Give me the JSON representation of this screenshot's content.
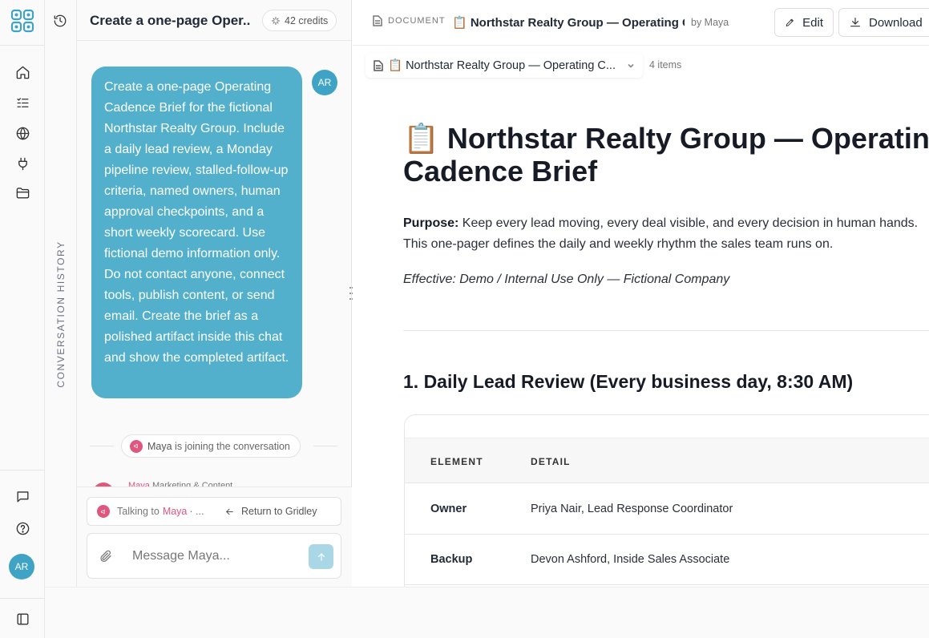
{
  "rail": {
    "avatar_initials": "AR",
    "icons": [
      "home-icon",
      "tasks-icon",
      "globe-icon",
      "plug-icon",
      "folder-icon",
      "chat-icon",
      "help-icon",
      "sidebar-toggle-icon"
    ],
    "accent_color": "#3fa3c6"
  },
  "history": {
    "label": "CONVERSATION HISTORY"
  },
  "chat": {
    "title": "Create a one-page Oper...",
    "credits": "42 credits",
    "user_initials": "AR",
    "message": "Create a one-page Operating Cadence Brief for the fictional Northstar Realty Group. Include a daily lead review, a Monday pipeline review, stalled-follow-up criteria, named owners, human approval checkpoints, and a short weekly scorecard. Use fictional demo information only. Do not contact anyone, connect tools, publish content, or send email. Create the brief as a polished artifact inside this chat and show the completed artifact.",
    "join_name": "Maya",
    "join_text": " is joining the conversation",
    "peek_name": "Maya",
    "peek_role": "Marketing & Content",
    "talking_prefix": "Talking to",
    "talking_name": "Maya",
    "talking_suffix": " · ...",
    "return_label": "Return to Gridley",
    "input_placeholder": "Message Maya...",
    "bubble_color": "#52b0cc",
    "maya_color": "#e0567e"
  },
  "document": {
    "tag": "DOCUMENT",
    "title_short": "📋 Northstar Realty Group — Operating C...",
    "by": "by Maya",
    "edit_label": "Edit",
    "download_label": "Download",
    "file_name": "📋 Northstar Realty Group — Operating C...",
    "items_count": "4 items",
    "heading": "📋 Northstar Realty Group — Operating Cadence Brief",
    "purpose_label": "Purpose:",
    "purpose_text": " Keep every lead moving, every deal visible, and every decision in human hands. This one-pager defines the daily and weekly rhythm the sales team runs on.",
    "effective": "Effective: Demo / Internal Use Only — Fictional Company",
    "section_1": "1. Daily Lead Review (Every business day, 8:30 AM)",
    "table": {
      "headers": [
        "ELEMENT",
        "DETAIL"
      ],
      "rows": [
        {
          "element": "Owner",
          "detail": "Priya Nair, Lead Response Coordinator"
        },
        {
          "element": "Backup",
          "detail": "Devon Ashford, Inside Sales Associate"
        }
      ]
    }
  }
}
